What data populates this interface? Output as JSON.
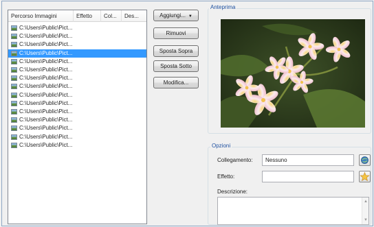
{
  "list": {
    "columns": [
      "Percorso Immagini",
      "Effetto",
      "Col...",
      "Des..."
    ],
    "rows": [
      "C:\\Users\\Public\\Pict...",
      "C:\\Users\\Public\\Pict...",
      "C:\\Users\\Public\\Pict...",
      "C:\\Users\\Public\\Pict...",
      "C:\\Users\\Public\\Pict...",
      "C:\\Users\\Public\\Pict...",
      "C:\\Users\\Public\\Pict...",
      "C:\\Users\\Public\\Pict...",
      "C:\\Users\\Public\\Pict...",
      "C:\\Users\\Public\\Pict...",
      "C:\\Users\\Public\\Pict...",
      "C:\\Users\\Public\\Pict...",
      "C:\\Users\\Public\\Pict...",
      "C:\\Users\\Public\\Pict...",
      "C:\\Users\\Public\\Pict..."
    ],
    "selected_index": 3
  },
  "buttons": {
    "add": "Aggiungi...",
    "remove": "Rimuovi",
    "move_up": "Sposta Sopra",
    "move_down": "Sposta Sotto",
    "edit": "Modifica..."
  },
  "preview": {
    "title": "Anteprima"
  },
  "options": {
    "title": "Opzioni",
    "link_label": "Collegamento:",
    "link_value": "Nessuno",
    "effect_label": "Effetto:",
    "effect_value": "",
    "description_label": "Descrizione:",
    "description_value": ""
  },
  "colors": {
    "selection": "#3399ff",
    "group_title": "#1e50a0"
  }
}
